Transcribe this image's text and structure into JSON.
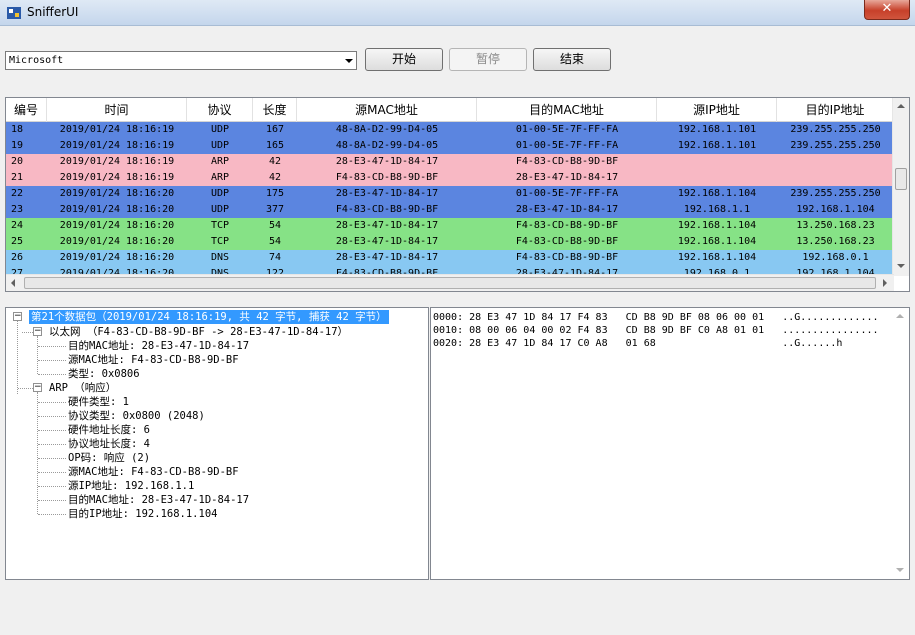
{
  "window": {
    "title": "SnifferUI",
    "close_glyph": "✕"
  },
  "toolbar": {
    "adapter_value": "Microsoft",
    "start_label": "开始",
    "pause_label": "暂停",
    "end_label": "结束"
  },
  "table": {
    "columns": [
      "编号",
      "时间",
      "协议",
      "长度",
      "源MAC地址",
      "目的MAC地址",
      "源IP地址",
      "目的IP地址"
    ],
    "rows": [
      {
        "no": "18",
        "time": "2019/01/24 18:16:19",
        "proto": "UDP",
        "len": "167",
        "src_mac": "48-8A-D2-99-D4-05",
        "dst_mac": "01-00-5E-7F-FF-FA",
        "src_ip": "192.168.1.101",
        "dst_ip": "239.255.255.250",
        "color": "#5b85e0",
        "fg": "#000000"
      },
      {
        "no": "19",
        "time": "2019/01/24 18:16:19",
        "proto": "UDP",
        "len": "165",
        "src_mac": "48-8A-D2-99-D4-05",
        "dst_mac": "01-00-5E-7F-FF-FA",
        "src_ip": "192.168.1.101",
        "dst_ip": "239.255.255.250",
        "color": "#5b85e0",
        "fg": "#000000"
      },
      {
        "no": "20",
        "time": "2019/01/24 18:16:19",
        "proto": "ARP",
        "len": "42",
        "src_mac": "28-E3-47-1D-84-17",
        "dst_mac": "F4-83-CD-B8-9D-BF",
        "src_ip": "",
        "dst_ip": "",
        "color": "#f8b8c4",
        "fg": "#000000"
      },
      {
        "no": "21",
        "time": "2019/01/24 18:16:19",
        "proto": "ARP",
        "len": "42",
        "src_mac": "F4-83-CD-B8-9D-BF",
        "dst_mac": "28-E3-47-1D-84-17",
        "src_ip": "",
        "dst_ip": "",
        "color": "#f8b8c4",
        "fg": "#000000"
      },
      {
        "no": "22",
        "time": "2019/01/24 18:16:20",
        "proto": "UDP",
        "len": "175",
        "src_mac": "28-E3-47-1D-84-17",
        "dst_mac": "01-00-5E-7F-FF-FA",
        "src_ip": "192.168.1.104",
        "dst_ip": "239.255.255.250",
        "color": "#5b85e0",
        "fg": "#000000"
      },
      {
        "no": "23",
        "time": "2019/01/24 18:16:20",
        "proto": "UDP",
        "len": "377",
        "src_mac": "F4-83-CD-B8-9D-BF",
        "dst_mac": "28-E3-47-1D-84-17",
        "src_ip": "192.168.1.1",
        "dst_ip": "192.168.1.104",
        "color": "#5b85e0",
        "fg": "#000000"
      },
      {
        "no": "24",
        "time": "2019/01/24 18:16:20",
        "proto": "TCP",
        "len": "54",
        "src_mac": "28-E3-47-1D-84-17",
        "dst_mac": "F4-83-CD-B8-9D-BF",
        "src_ip": "192.168.1.104",
        "dst_ip": "13.250.168.23",
        "color": "#86e286",
        "fg": "#000000"
      },
      {
        "no": "25",
        "time": "2019/01/24 18:16:20",
        "proto": "TCP",
        "len": "54",
        "src_mac": "28-E3-47-1D-84-17",
        "dst_mac": "F4-83-CD-B8-9D-BF",
        "src_ip": "192.168.1.104",
        "dst_ip": "13.250.168.23",
        "color": "#86e286",
        "fg": "#000000"
      },
      {
        "no": "26",
        "time": "2019/01/24 18:16:20",
        "proto": "DNS",
        "len": "74",
        "src_mac": "28-E3-47-1D-84-17",
        "dst_mac": "F4-83-CD-B8-9D-BF",
        "src_ip": "192.168.1.104",
        "dst_ip": "192.168.0.1",
        "color": "#88c8f2",
        "fg": "#000000"
      },
      {
        "no": "27",
        "time": "2019/01/24 18:16:20",
        "proto": "DNS",
        "len": "122",
        "src_mac": "F4-83-CD-B8-9D-BF",
        "dst_mac": "28-E3-47-1D-84-17",
        "src_ip": "192.168.0.1",
        "dst_ip": "192.168.1.104",
        "color": "#88c8f2",
        "fg": "#000000"
      }
    ]
  },
  "tree": {
    "root": "第21个数据包（2019/01/24 18:16:19, 共 42 字节, 捕获 42 字节）",
    "eth": "以太网 （F4-83-CD-B8-9D-BF -> 28-E3-47-1D-84-17）",
    "eth_children": [
      "目的MAC地址: 28-E3-47-1D-84-17",
      "源MAC地址: F4-83-CD-B8-9D-BF",
      "类型: 0x0806"
    ],
    "arp": "ARP （响应）",
    "arp_children": [
      "硬件类型: 1",
      "协议类型: 0x0800 (2048)",
      "硬件地址长度: 6",
      "协议地址长度: 4",
      "OP码: 响应 (2)",
      "源MAC地址: F4-83-CD-B8-9D-BF",
      "源IP地址: 192.168.1.1",
      "目的MAC地址: 28-E3-47-1D-84-17",
      "目的IP地址: 192.168.1.104"
    ]
  },
  "hex": {
    "lines": [
      "0000: 28 E3 47 1D 84 17 F4 83   CD B8 9D BF 08 06 00 01   ..G.............",
      "0010: 08 00 06 04 00 02 F4 83   CD B8 9D BF C0 A8 01 01   ................",
      "0020: 28 E3 47 1D 84 17 C0 A8   01 68                     ..G......h"
    ]
  },
  "colors": {
    "selected": "#3399ff",
    "udp": "#5b85e0",
    "arp": "#f8b8c4",
    "tcp": "#86e286",
    "dns": "#88c8f2"
  }
}
